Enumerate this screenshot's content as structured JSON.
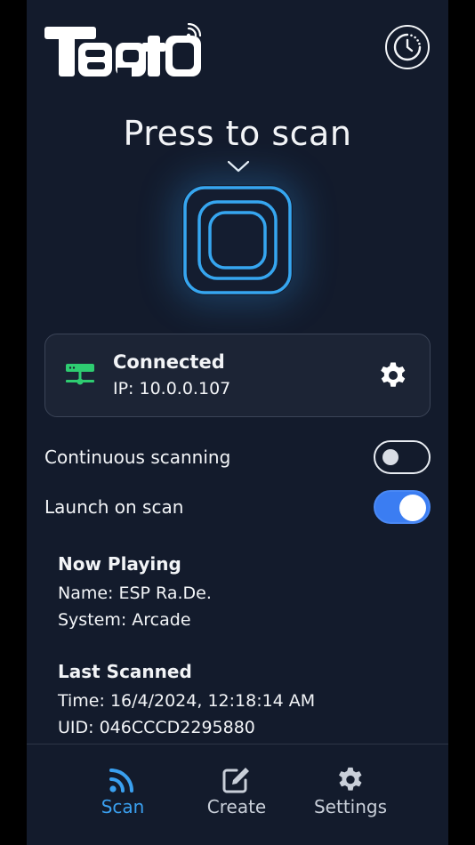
{
  "header": {
    "logo_text": "TapTo",
    "history_icon": "history-clock-icon"
  },
  "scan": {
    "prompt": "Press to scan"
  },
  "connection": {
    "status": "Connected",
    "ip": "IP: 10.0.0.107",
    "status_color": "#2ecc71"
  },
  "toggles": [
    {
      "label": "Continuous scanning",
      "enabled": false
    },
    {
      "label": "Launch on scan",
      "enabled": true
    }
  ],
  "now_playing": {
    "heading": "Now Playing",
    "name": "Name: ESP Ra.De.",
    "system": "System: Arcade"
  },
  "last_scanned": {
    "heading": "Last Scanned",
    "time": "Time: 16/4/2024, 12:18:14 AM",
    "uid": "UID: 046CCCD2295880"
  },
  "tabs": [
    {
      "label": "Scan",
      "icon": "nfc-waves-icon",
      "active": true
    },
    {
      "label": "Create",
      "icon": "edit-icon",
      "active": false
    },
    {
      "label": "Settings",
      "icon": "gear-icon",
      "active": false
    }
  ],
  "colors": {
    "background": "#131b2c",
    "accent": "#3aa0f0",
    "toggle_on": "#3b7df2"
  }
}
